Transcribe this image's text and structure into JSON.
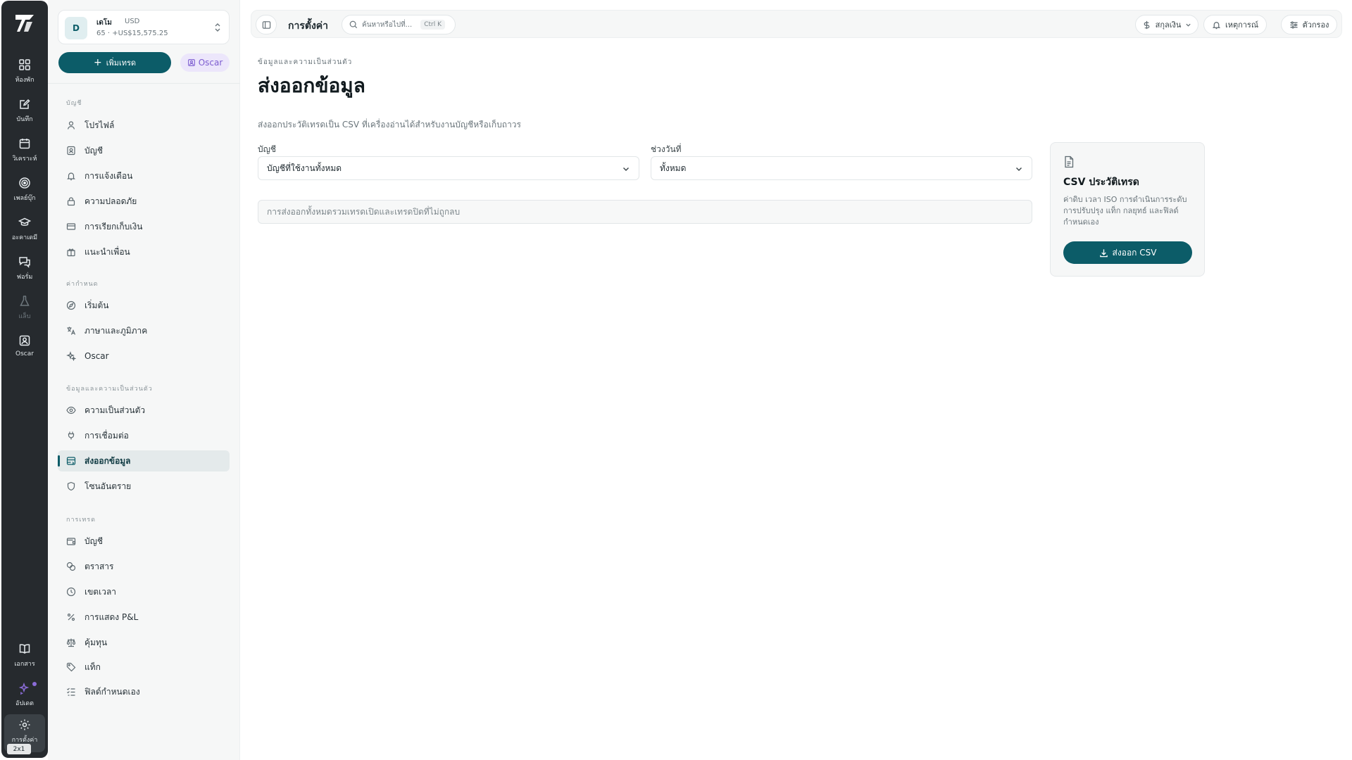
{
  "rail": {
    "items": [
      {
        "label": "ห้องพัก",
        "icon": "grid-icon"
      },
      {
        "label": "บันทึก",
        "icon": "journal-edit-icon"
      },
      {
        "label": "วิเคราะห์",
        "icon": "calendar-icon"
      },
      {
        "label": "เพลย์บุ๊ก",
        "icon": "target-icon"
      },
      {
        "label": "อะคาเดมี",
        "icon": "graduation-cap-icon"
      },
      {
        "label": "ฟอรั่ม",
        "icon": "chat-bubbles-icon"
      },
      {
        "label": "แล็บ",
        "icon": "flask-icon"
      },
      {
        "label": "Oscar",
        "icon": "oscar-icon"
      }
    ],
    "bottom": [
      {
        "label": "เอกสาร",
        "icon": "book-icon"
      },
      {
        "label": "อัปเดต",
        "icon": "sparkle-icon"
      },
      {
        "label": "การตั้งค่า",
        "icon": "gear-icon"
      }
    ],
    "badge": "2x1"
  },
  "account": {
    "avatar": "D",
    "name": "เดโม",
    "currency": "USD",
    "sub": "65 · +US$15,575.25"
  },
  "sidebar": {
    "add_trade": "เพิ่มเทรด",
    "oscar_chip": "Oscar",
    "sections": [
      {
        "title": "บัญชี",
        "items": [
          "โปรไฟล์",
          "บัญชี",
          "การแจ้งเตือน",
          "ความปลอดภัย",
          "การเรียกเก็บเงิน",
          "แนะนำเพื่อน"
        ]
      },
      {
        "title": "ค่ากำหนด",
        "items": [
          "เริ่มต้น",
          "ภาษาและภูมิภาค",
          "Oscar"
        ]
      },
      {
        "title": "ข้อมูลและความเป็นส่วนตัว",
        "items": [
          "ความเป็นส่วนตัว",
          "การเชื่อมต่อ",
          "ส่งออกข้อมูล",
          "โซนอันตราย"
        ]
      },
      {
        "title": "การเทรด",
        "items": [
          "บัญชี",
          "ตราสาร",
          "เขตเวลา",
          "การแสดง P&L",
          "คุ้มทุน",
          "แท็ก",
          "ฟิลด์กำหนดเอง"
        ]
      }
    ]
  },
  "topbar": {
    "title": "การตั้งค่า",
    "search_placeholder": "ค้นหาหรือไปที่...",
    "search_kbd": "Ctrl K",
    "currency": "สกุลเงิน",
    "events": "เหตุการณ์",
    "filter": "ตัวกรอง"
  },
  "main": {
    "breadcrumb": "ข้อมูลและความเป็นส่วนตัว",
    "title": "ส่งออกข้อมูล",
    "description": "ส่งออกประวัติเทรดเป็น CSV ที่เครื่องอ่านได้สำหรับงานบัญชีหรือเก็บถาวร",
    "account_label": "บัญชี",
    "account_value": "บัญชีที่ใช้งานทั้งหมด",
    "range_label": "ช่วงวันที่",
    "range_value": "ทั้งหมด",
    "note_placeholder": "การส่งออกทั้งหมดรวมเทรดเปิดและเทรดปิดที่ไม่ถูกลบ"
  },
  "card": {
    "title": "CSV ประวัติเทรด",
    "description": "ค่าดิบ เวลา ISO การดำเนินการระดับ การปรับปรุง แท็ก กลยุทธ์ และฟิลด์กำหนดเอง",
    "button": "ส่งออก CSV"
  },
  "colors": {
    "accent": "#0c5c68",
    "rail": "#262a2e",
    "oscar": "#7c5cd0"
  }
}
